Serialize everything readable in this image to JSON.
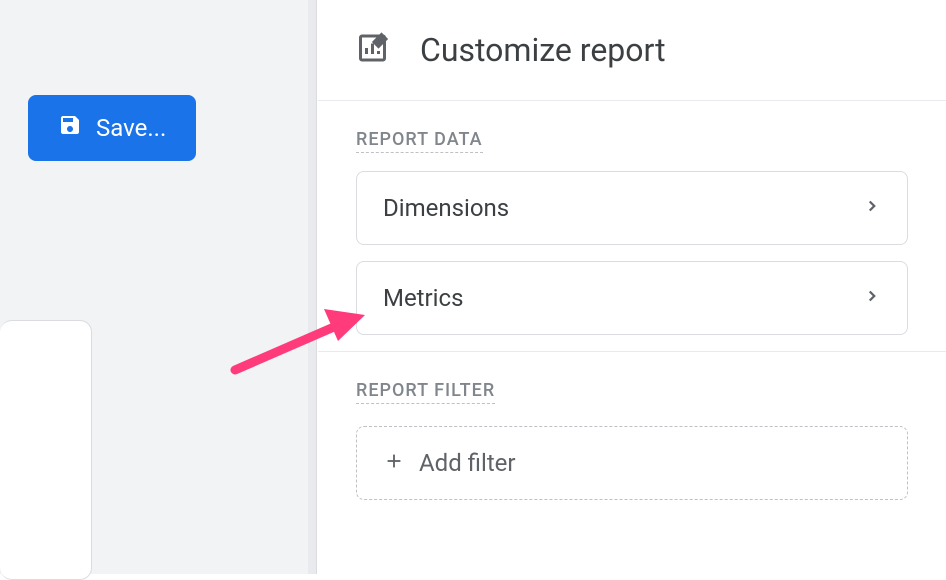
{
  "left": {
    "save_label": "Save..."
  },
  "header": {
    "title": "Customize report"
  },
  "sections": {
    "data": {
      "label": "REPORT DATA",
      "dimensions": "Dimensions",
      "metrics": "Metrics"
    },
    "filter": {
      "label": "REPORT FILTER",
      "add_filter": "Add filter"
    }
  }
}
